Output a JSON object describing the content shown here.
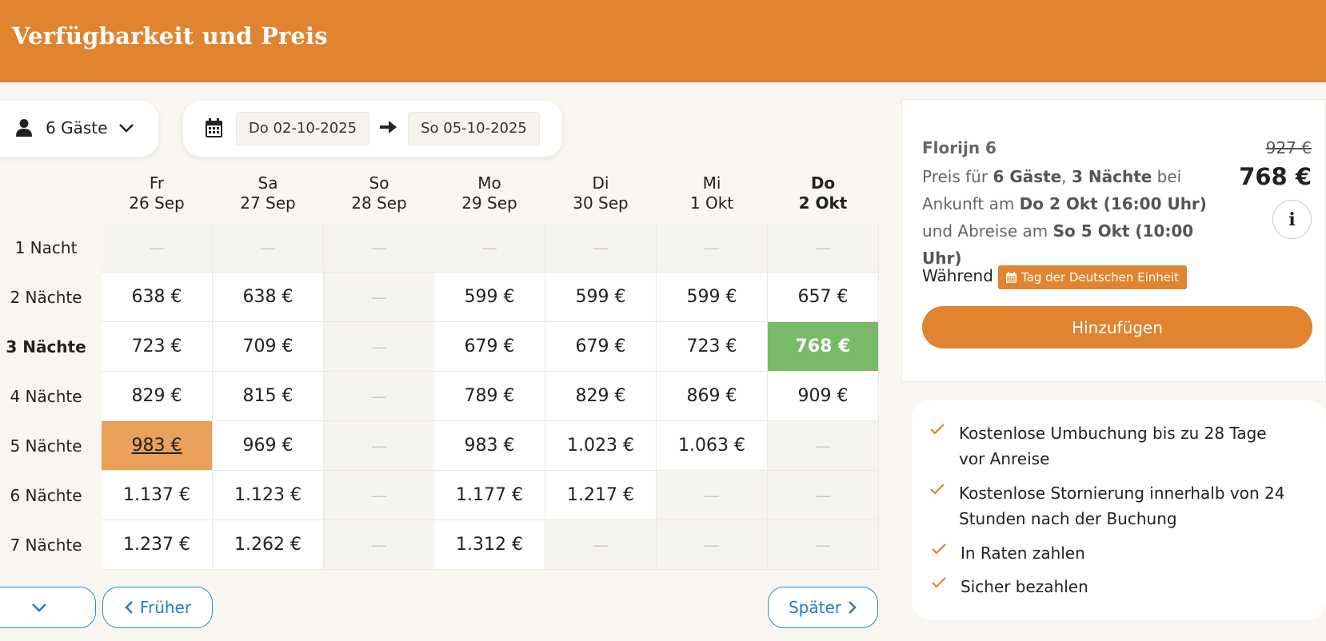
{
  "header": {
    "title": "Verfügbarkeit und Preis"
  },
  "guests": {
    "label": "6 Gäste"
  },
  "dates": {
    "checkin": "Do 02-10-2025",
    "checkout": "So 05-10-2025"
  },
  "columns": [
    {
      "day": "Fr",
      "date": "26 Sep"
    },
    {
      "day": "Sa",
      "date": "27 Sep"
    },
    {
      "day": "So",
      "date": "28 Sep"
    },
    {
      "day": "Mo",
      "date": "29 Sep"
    },
    {
      "day": "Di",
      "date": "30 Sep"
    },
    {
      "day": "Mi",
      "date": "1 Okt"
    },
    {
      "day": "Do",
      "date": "2 Okt"
    }
  ],
  "rows": [
    {
      "label": "1 Nacht",
      "cells": [
        "—",
        "—",
        "—",
        "—",
        "—",
        "—",
        "—"
      ]
    },
    {
      "label": "2 Nächte",
      "cells": [
        "638 €",
        "638 €",
        "—",
        "599 €",
        "599 €",
        "599 €",
        "657 €"
      ]
    },
    {
      "label": "3 Nächte",
      "cells": [
        "723 €",
        "709 €",
        "—",
        "679 €",
        "679 €",
        "723 €",
        "768 €"
      ]
    },
    {
      "label": "4 Nächte",
      "cells": [
        "829 €",
        "815 €",
        "—",
        "789 €",
        "829 €",
        "869 €",
        "909 €"
      ]
    },
    {
      "label": "5 Nächte",
      "cells": [
        "983 €",
        "969 €",
        "—",
        "983 €",
        "1.023 €",
        "1.063 €",
        "—"
      ]
    },
    {
      "label": "6 Nächte",
      "cells": [
        "1.137 €",
        "1.123 €",
        "—",
        "1.177 €",
        "1.217 €",
        "—",
        "—"
      ]
    },
    {
      "label": "7 Nächte",
      "cells": [
        "1.237 €",
        "1.262 €",
        "—",
        "1.312 €",
        "—",
        "—",
        "—"
      ]
    }
  ],
  "selected": {
    "row": 2,
    "col": 6
  },
  "hovered": {
    "row": 4,
    "col": 0
  },
  "nav": {
    "earlier": "Früher",
    "later": "Später"
  },
  "summary": {
    "name": "Florijn 6",
    "old_price": "927 €",
    "price": "768 €",
    "desc": {
      "t1": "Preis für ",
      "guests": "6 Gäste",
      "t2": ", ",
      "nights": "3 Nächte",
      "t3": " bei Ankunft am ",
      "arrival": "Do 2 Okt (16:00 Uhr)",
      "t4": " und Abreise am ",
      "departure": "So 5 Okt (10:00 Uhr)"
    },
    "info_label": "i",
    "during": "Während",
    "holiday": "Tag der Deutschen Einheit",
    "add_label": "Hinzufügen"
  },
  "perks": [
    "Kostenlose Umbuchung bis zu 28 Tage vor Anreise",
    "Kostenlose Stornierung innerhalb von 24 Stunden nach der Buchung",
    "In Raten zahlen",
    "Sicher bezahlen"
  ],
  "colors": {
    "accent": "#e08430",
    "selected": "#79b96a",
    "hover": "#e8a05a",
    "link": "#1f7fc4"
  },
  "icons": [
    "person-icon",
    "chevron-down-icon",
    "calendar-icon",
    "arrow-right-icon",
    "chevron-left-icon",
    "chevron-right-icon",
    "info-icon",
    "check-icon"
  ]
}
